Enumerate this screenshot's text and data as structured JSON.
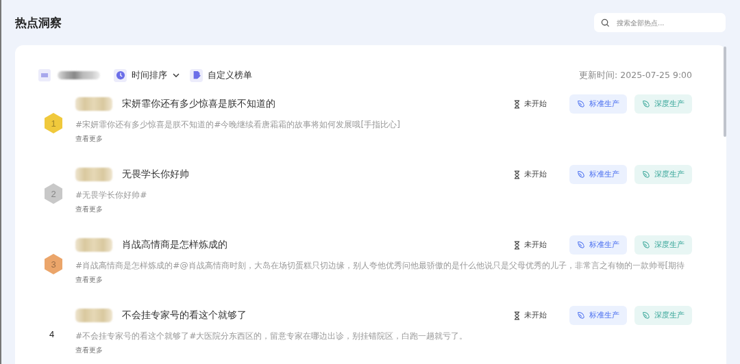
{
  "header": {
    "title": "热点洞察",
    "search": {
      "placeholder": "搜索全部热点..."
    }
  },
  "toolbar": {
    "sort": {
      "label": "时间排序",
      "expanded": false
    },
    "custom": {
      "label": "自定义榜单"
    },
    "updated_label": "更新时间:",
    "updated_value": "2025-07-25 9:00"
  },
  "items": [
    {
      "rank": "1",
      "kind": "medal",
      "color": "#f0c93c",
      "title": "宋妍霏你还有多少惊喜是朕不知道的",
      "description": "#宋妍霏你还有多少惊喜是朕不知道的#今晚继续看唐霜霜的故事将如何发展哦[手指比心]",
      "more": "查看更多",
      "status": "未开始",
      "actions": [
        "标准生产",
        "深度生产"
      ]
    },
    {
      "rank": "2",
      "kind": "medal",
      "color": "#c8c8c8",
      "title": "无畏学长你好帅",
      "description": "#无畏学长你好帅#",
      "more": "查看更多",
      "status": "未开始",
      "actions": [
        "标准生产",
        "深度生产"
      ]
    },
    {
      "rank": "3",
      "kind": "medal",
      "color": "#eba56a",
      "title": "肖战高情商是怎样炼成的",
      "description": "#肖战高情商是怎样炼成的#@肖战高情商时刻，大岛在场切蛋糕只切边缘，别人夸他优秀问他最骄傲的是什么他说只是父母优秀的儿子，非常言之有物的一款帅哥[期待",
      "more": "查看更多",
      "status": "未开始",
      "actions": [
        "标准生产",
        "深度生产"
      ]
    },
    {
      "rank": "4",
      "kind": "plain",
      "title": "不会挂专家号的看这个就够了",
      "description": "#不会挂专家号的看这个就够了#大医院分东西区的，留意专家在哪边出诊，别挂错院区，白跑一趟就亏了。",
      "more": "查看更多",
      "status": "未开始",
      "actions": [
        "标准生产",
        "深度生产"
      ]
    }
  ]
}
